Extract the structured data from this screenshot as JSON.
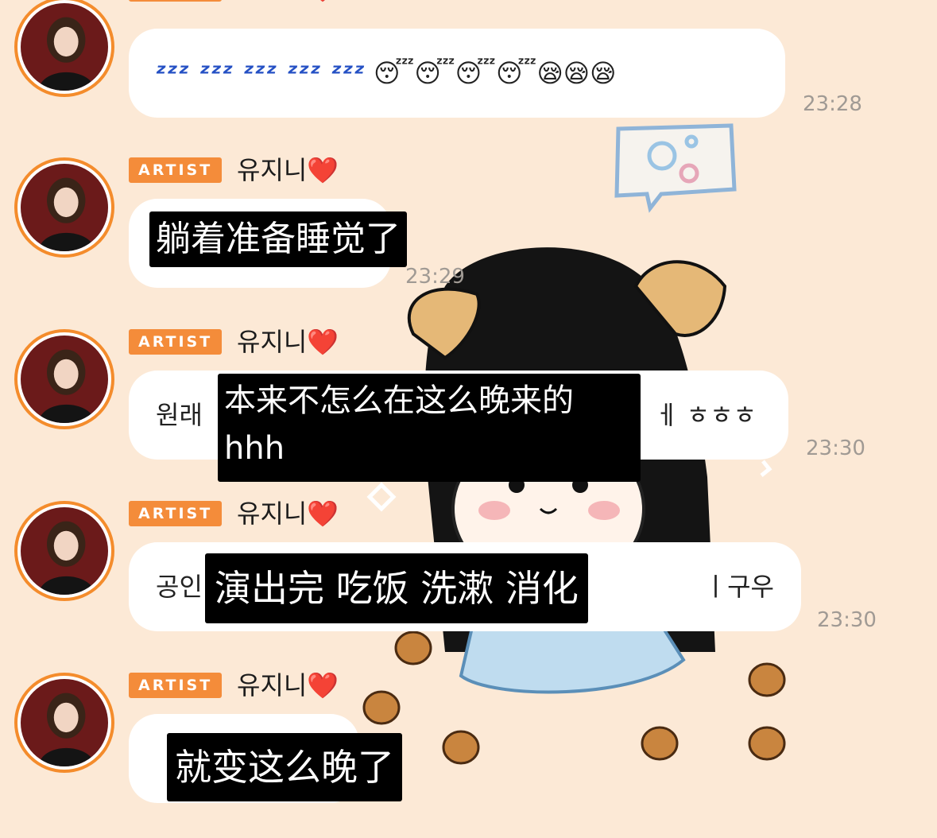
{
  "sender": {
    "badge": "ARTIST",
    "name": "유지니❤️"
  },
  "messages": [
    {
      "text": "ᶻᶻᶻ ᶻᶻᶻ ᶻᶻᶻ ᶻᶻᶻ ᶻᶻᶻ",
      "emoji": "😴😴😴😴😪😪😪",
      "time": "23:28"
    },
    {
      "text": "",
      "time": "23:29",
      "subtitle": "躺着准备睡觉了"
    },
    {
      "text_start": "원래",
      "text_end": "ㅔ ㅎㅎㅎ",
      "time": "23:30",
      "subtitle": "本来不怎么在这么晚来的",
      "subtitle_line2": "hhh"
    },
    {
      "text_start": "공인",
      "text_end": "ㅣ구우",
      "time": "23:30",
      "subtitle": "演出完 吃饭 洗漱 消化"
    },
    {
      "text_start": "",
      "time": "",
      "subtitle": "就变这么晚了"
    }
  ],
  "colors": {
    "background": "#fce9d6",
    "badge": "#f48c3a",
    "avatar_ring": "#f48c2c",
    "bubble": "#ffffff",
    "time": "#a09a94"
  }
}
